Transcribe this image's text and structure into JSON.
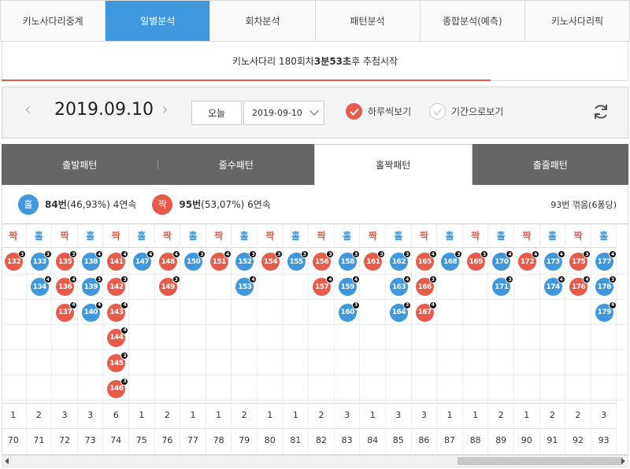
{
  "nav": {
    "tabs": [
      "키노사다리중계",
      "일별분석",
      "회차분석",
      "패턴분석",
      "종합분석(예측)",
      "키노사다리픽"
    ],
    "active": 1
  },
  "notice": {
    "prefix": "키노사다리 180회차 ",
    "min": "3분",
    "min_sep": " ",
    "sec": "53초",
    "suffix": "후 추첨시작",
    "progress": 0.78
  },
  "datebar": {
    "date": "2019.09.10",
    "today": "오늘",
    "select_value": "2019-09-10",
    "daily": "하루씩보기",
    "period": "기간으로보기"
  },
  "subtabs": {
    "tabs": [
      "출발패턴",
      "줄수패턴",
      "홀짝패턴",
      "출줄패턴"
    ],
    "active": 2
  },
  "summary": {
    "odd_label": "홀",
    "odd_count": "84번",
    "odd_pct": " (46,93%) 4연속",
    "even_label": "짝",
    "even_count": "95번",
    "even_pct": " (53,07%) 6연속",
    "right": "93번 꺾음(6퐁당)"
  },
  "colors": {
    "odd": "#3f97dc",
    "even": "#e65b4b",
    "active_tab": "#3f97dc"
  },
  "labels": {
    "odd": "홀",
    "even": "짝"
  },
  "columns": [
    {
      "t": "짝",
      "balls": [
        [
          "132",
          "3"
        ]
      ],
      "cnt": "1",
      "num": "70"
    },
    {
      "t": "홀",
      "balls": [
        [
          "133",
          "3"
        ],
        [
          "134",
          "4"
        ]
      ],
      "cnt": "2",
      "num": "71"
    },
    {
      "t": "짝",
      "balls": [
        [
          "135",
          "3"
        ],
        [
          "136",
          "4"
        ],
        [
          "137",
          "4"
        ]
      ],
      "cnt": "3",
      "num": "72"
    },
    {
      "t": "홀",
      "balls": [
        [
          "138",
          "4"
        ],
        [
          "139",
          "3"
        ],
        [
          "140",
          "4"
        ]
      ],
      "cnt": "3",
      "num": "73"
    },
    {
      "t": "짝",
      "balls": [
        [
          "141",
          "4"
        ],
        [
          "142",
          "3"
        ],
        [
          "143",
          "4"
        ],
        [
          "144",
          "4"
        ],
        [
          "145",
          "3"
        ],
        [
          "146",
          "3"
        ]
      ],
      "cnt": "6",
      "num": "74"
    },
    {
      "t": "홀",
      "balls": [
        [
          "147",
          "4"
        ]
      ],
      "cnt": "1",
      "num": "75"
    },
    {
      "t": "짝",
      "balls": [
        [
          "148",
          "4"
        ],
        [
          "149",
          "3"
        ]
      ],
      "cnt": "2",
      "num": "76"
    },
    {
      "t": "홀",
      "balls": [
        [
          "150",
          "3"
        ]
      ],
      "cnt": "1",
      "num": "77"
    },
    {
      "t": "짝",
      "balls": [
        [
          "151",
          "4"
        ]
      ],
      "cnt": "1",
      "num": "78"
    },
    {
      "t": "홀",
      "balls": [
        [
          "152",
          "3"
        ],
        [
          "153",
          "4"
        ]
      ],
      "cnt": "2",
      "num": "79"
    },
    {
      "t": "짝",
      "balls": [
        [
          "154",
          "3"
        ]
      ],
      "cnt": "1",
      "num": "80"
    },
    {
      "t": "홀",
      "balls": [
        [
          "155",
          "3"
        ]
      ],
      "cnt": "1",
      "num": "81"
    },
    {
      "t": "짝",
      "balls": [
        [
          "156",
          "3"
        ],
        [
          "157",
          "4"
        ]
      ],
      "cnt": "2",
      "num": "82"
    },
    {
      "t": "홀",
      "balls": [
        [
          "158",
          "3"
        ],
        [
          "159",
          "4"
        ],
        [
          "160",
          "3"
        ]
      ],
      "cnt": "3",
      "num": "83"
    },
    {
      "t": "짝",
      "balls": [
        [
          "161",
          "3"
        ]
      ],
      "cnt": "1",
      "num": "84"
    },
    {
      "t": "홀",
      "balls": [
        [
          "162",
          "3"
        ],
        [
          "163",
          "4"
        ],
        [
          "164",
          "3"
        ]
      ],
      "cnt": "3",
      "num": "85"
    },
    {
      "t": "짝",
      "balls": [
        [
          "165",
          "4"
        ],
        [
          "166",
          "3"
        ],
        [
          "167",
          "4"
        ]
      ],
      "cnt": "3",
      "num": "86"
    },
    {
      "t": "홀",
      "balls": [
        [
          "168",
          "3"
        ]
      ],
      "cnt": "1",
      "num": "87"
    },
    {
      "t": "짝",
      "balls": [
        [
          "169",
          "3"
        ]
      ],
      "cnt": "1",
      "num": "88"
    },
    {
      "t": "홀",
      "balls": [
        [
          "170",
          "4"
        ],
        [
          "171",
          "3"
        ]
      ],
      "cnt": "2",
      "num": "89"
    },
    {
      "t": "짝",
      "balls": [
        [
          "172",
          "4"
        ]
      ],
      "cnt": "1",
      "num": "90"
    },
    {
      "t": "홀",
      "balls": [
        [
          "173",
          "4"
        ],
        [
          "174",
          "4"
        ]
      ],
      "cnt": "2",
      "num": "91"
    },
    {
      "t": "짝",
      "balls": [
        [
          "175",
          "3"
        ],
        [
          "176",
          "4"
        ]
      ],
      "cnt": "2",
      "num": "92"
    },
    {
      "t": "홀",
      "balls": [
        [
          "177",
          "4"
        ],
        [
          "178",
          "3"
        ],
        [
          "179",
          "4"
        ]
      ],
      "cnt": "3",
      "num": "93"
    }
  ]
}
